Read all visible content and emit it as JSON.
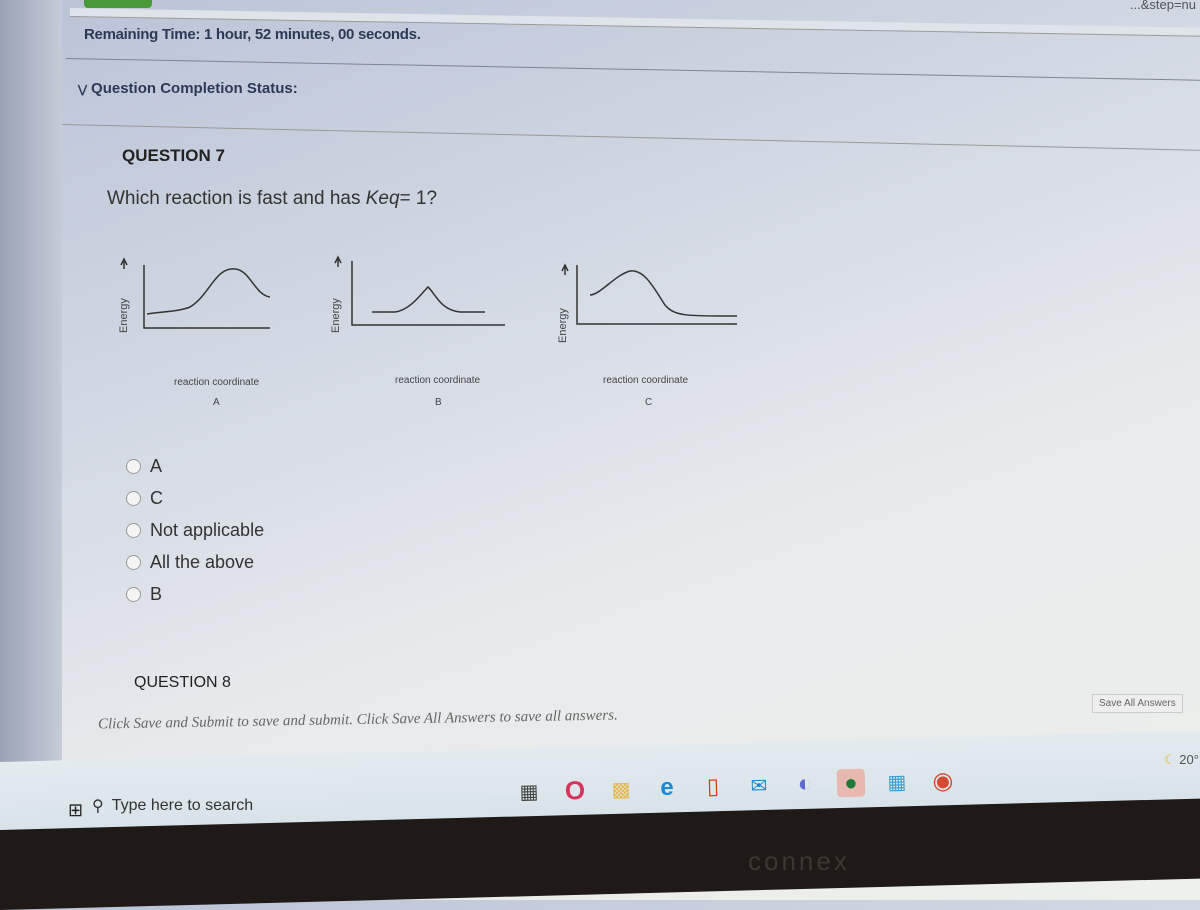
{
  "browser": {
    "url_fragment": "...&step=nu"
  },
  "timer": {
    "text": "Remaining Time: 1 hour, 52 minutes, 00 seconds."
  },
  "completion_status": {
    "label": "Question Completion Status:"
  },
  "question7": {
    "title": "QUESTION 7",
    "text_prefix": "Which reaction is fast and has ",
    "text_italic": "Keq",
    "text_suffix": "= 1?",
    "diagrams": [
      {
        "y_label": "Energy",
        "x_label": "reaction coordinate",
        "name": "A"
      },
      {
        "y_label": "Energy",
        "x_label": "reaction coordinate",
        "name": "B"
      },
      {
        "y_label": "Energy",
        "x_label": "reaction coordinate",
        "name": "C"
      }
    ],
    "options": [
      "A",
      "C",
      "Not applicable",
      "All the above",
      "B"
    ]
  },
  "question8": {
    "title": "QUESTION 8"
  },
  "footer": {
    "instruction": "Click Save and Submit to save and submit. Click Save All Answers to save all answers.",
    "save_all_label": "Save All Answers"
  },
  "taskbar": {
    "search_placeholder": "Type here to search",
    "icons": [
      "task-view",
      "opera",
      "file-explorer",
      "edge",
      "office",
      "mail",
      "app",
      "spotify",
      "app2",
      "chrome"
    ],
    "temperature": "20°"
  },
  "bezel": {
    "brand": "connex"
  }
}
